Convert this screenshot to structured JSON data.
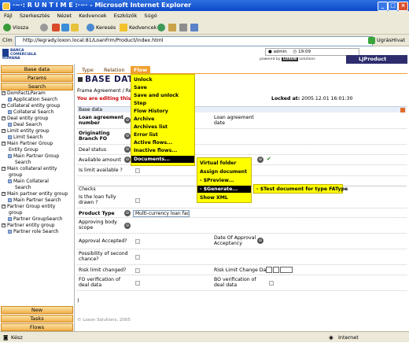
{
  "window": {
    "title": "·~·: R U N T I M E :·~· - Microsoft Internet Explorer"
  },
  "menubar": [
    "Fájl",
    "Szerkesztés",
    "Nézet",
    "Kedvencek",
    "Eszközök",
    "Súgó"
  ],
  "toolbar": {
    "back": "Vissza",
    "search": "Keresés",
    "favorites": "Kedvencek"
  },
  "address": {
    "label": "Cím",
    "url": "http://legrady.loxon.local:81/LoanFrm/Product/index.html",
    "go": "Ugrás",
    "links": "Hivat"
  },
  "header": {
    "logo_text": "BANCA COMERCIALA ROMANA",
    "user": "admin",
    "time": "19:09",
    "powered_by": "powered by",
    "vendor": "LOXON",
    "vendor_sub": "solutions",
    "product": "LJProduct"
  },
  "sidebar": {
    "top_buttons": [
      "Base data",
      "Params",
      "Search"
    ],
    "tree": [
      {
        "label": "DomFactLParam",
        "level": 0,
        "type": "group"
      },
      {
        "label": "Application Search",
        "level": 1,
        "type": "leaf"
      },
      {
        "label": "Collateral entity group",
        "level": 0,
        "type": "group"
      },
      {
        "label": "Collateral Search",
        "level": 1,
        "type": "leaf"
      },
      {
        "label": "Deal entity group",
        "level": 0,
        "type": "group"
      },
      {
        "label": "Deal Search",
        "level": 1,
        "type": "leaf"
      },
      {
        "label": "Limit entity group",
        "level": 0,
        "type": "group"
      },
      {
        "label": "Limit Search",
        "level": 1,
        "type": "leaf"
      },
      {
        "label": "Main Partner Group",
        "level": 0,
        "type": "group"
      },
      {
        "label": "Entity Group",
        "level": 0,
        "type": "cont"
      },
      {
        "label": "Main Partner Group",
        "level": 1,
        "type": "leaf"
      },
      {
        "label": "Search",
        "level": 1,
        "type": "cont"
      },
      {
        "label": "Main collateral entity",
        "level": 0,
        "type": "group"
      },
      {
        "label": "group",
        "level": 0,
        "type": "cont"
      },
      {
        "label": "Main Collateral",
        "level": 1,
        "type": "leaf"
      },
      {
        "label": "Search",
        "level": 1,
        "type": "cont"
      },
      {
        "label": "Main partner entity group",
        "level": 0,
        "type": "group"
      },
      {
        "label": "Main Partner Search",
        "level": 1,
        "type": "leaf"
      },
      {
        "label": "Partner Group entity",
        "level": 0,
        "type": "group"
      },
      {
        "label": "group",
        "level": 0,
        "type": "cont"
      },
      {
        "label": "Partner GroupSearch",
        "level": 1,
        "type": "leaf"
      },
      {
        "label": "Partner entity group",
        "level": 0,
        "type": "group"
      },
      {
        "label": "Partner role Search",
        "level": 1,
        "type": "leaf"
      }
    ],
    "bottom_buttons": [
      "New",
      "Tasks",
      "Flows"
    ]
  },
  "tabs": [
    "Type",
    "Relation",
    "Flow"
  ],
  "main": {
    "title": "BASE DATA(",
    "breadcrumb": "Frame Agreement / Reco",
    "editing": "You are editing this it",
    "locked_label": "Locked at:",
    "locked_value": "2005.12.01 16:01:30",
    "section_base": "Base data",
    "section_checks": "Checks",
    "fields": {
      "loan_agreement_number": "Loan agreement number",
      "loan_agreement_date": "Loan agreement date",
      "originating_branch": "Originating Branch FO",
      "deal_status": "Deal status",
      "available_amount": "Available amount",
      "is_limit_available": "Is limit available ?",
      "is_loan_fully_drawn": "Is the loan fully drawn ?",
      "product_type": "Product Type",
      "product_type_value": "Multi-currency loan facility",
      "approving_body_scope": "Approving body scope",
      "approval_accepted": "Approval Accepted?",
      "date_of_approval": "Date Of Approval Acceptancy",
      "possibility_second_chance": "Possibility of second chance?",
      "risk_limit_changed": "Risk limit changed?",
      "risk_limit_change_date": "Risk Limit Change Date",
      "fo_verification": "FO verification of deal data",
      "bo_verification": "BO verification of deal data"
    },
    "closing_paren": ")",
    "footer": "© Loxon Solutions, 2005"
  },
  "flow_menu": [
    "Unlock",
    "Save",
    "Save and unlock",
    "Step",
    "Flow History",
    "Archive",
    "Archives list",
    "Error list",
    "Active flows...",
    "Inactive flows...",
    "Documents..."
  ],
  "documents_menu": [
    "Virtual folder",
    "Assign document",
    "- $Preview...",
    "- $Generate...",
    "Show XML"
  ],
  "generate_menu": [
    "- $Test document for type FAType"
  ],
  "statusbar": {
    "left": "Kész",
    "right": "Internet"
  },
  "colors": {
    "menu_yellow": "#ffff00",
    "tab_orange": "#f0a030",
    "title_blue": "#0c48c9"
  }
}
